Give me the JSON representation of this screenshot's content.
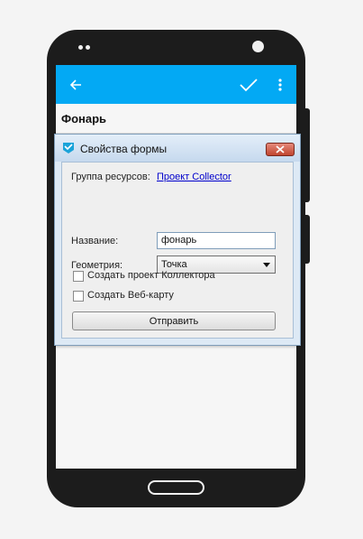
{
  "app": {
    "page_title": "Фонарь",
    "appbar_icons": {
      "back": "arrow-left-icon",
      "confirm": "checkmark-icon",
      "menu": "more-vert-icon"
    },
    "accent_color": "#03a9f4"
  },
  "dialog": {
    "title": "Свойства формы",
    "resource_group_label": "Группа ресурсов:",
    "resource_group_link": "Проект Collector",
    "name_label": "Название:",
    "name_value": "фонарь",
    "geometry_label": "Геометрия:",
    "geometry_value": "Точка",
    "create_collector_label": "Создать проект Коллектора",
    "create_webmap_label": "Создать Веб-карту",
    "submit_label": "Отправить"
  }
}
